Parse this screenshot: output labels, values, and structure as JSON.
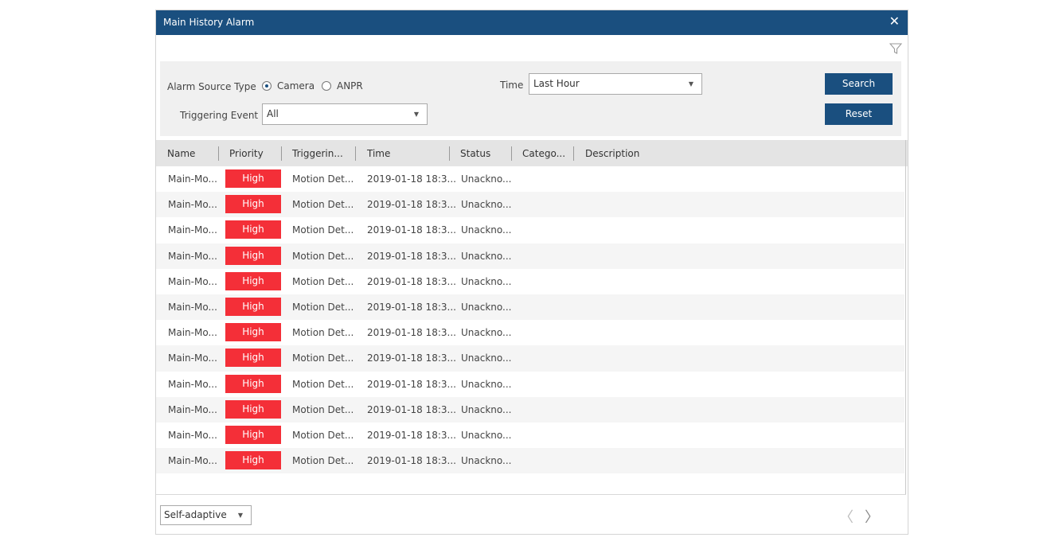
{
  "window": {
    "title": "Main History Alarm",
    "close_glyph": "✕",
    "close_icon": "close-icon",
    "filter_icon": "funnel-icon"
  },
  "filters": {
    "alarm_source_label": "Alarm Source Type",
    "source_options": [
      "Camera",
      "ANPR"
    ],
    "source_selected": "Camera",
    "time_label": "Time",
    "time_value": "Last Hour",
    "triggering_label": "Triggering Event",
    "triggering_value": "All",
    "search_label": "Search",
    "reset_label": "Reset"
  },
  "table": {
    "columns": [
      "Name",
      "Priority",
      "Triggerin...",
      "Time",
      "Status",
      "Catego...",
      "Description"
    ],
    "rows": [
      {
        "name": "Main-Mo...",
        "priority": "High",
        "trigger": "Motion Det...",
        "time": "2019-01-18 18:3...",
        "status": "Unackno..."
      },
      {
        "name": "Main-Mo...",
        "priority": "High",
        "trigger": "Motion Det...",
        "time": "2019-01-18 18:3...",
        "status": "Unackno..."
      },
      {
        "name": "Main-Mo...",
        "priority": "High",
        "trigger": "Motion Det...",
        "time": "2019-01-18 18:3...",
        "status": "Unackno..."
      },
      {
        "name": "Main-Mo...",
        "priority": "High",
        "trigger": "Motion Det...",
        "time": "2019-01-18 18:3...",
        "status": "Unackno..."
      },
      {
        "name": "Main-Mo...",
        "priority": "High",
        "trigger": "Motion Det...",
        "time": "2019-01-18 18:3...",
        "status": "Unackno..."
      },
      {
        "name": "Main-Mo...",
        "priority": "High",
        "trigger": "Motion Det...",
        "time": "2019-01-18 18:3...",
        "status": "Unackno..."
      },
      {
        "name": "Main-Mo...",
        "priority": "High",
        "trigger": "Motion Det...",
        "time": "2019-01-18 18:3...",
        "status": "Unackno..."
      },
      {
        "name": "Main-Mo...",
        "priority": "High",
        "trigger": "Motion Det...",
        "time": "2019-01-18 18:3...",
        "status": "Unackno..."
      },
      {
        "name": "Main-Mo...",
        "priority": "High",
        "trigger": "Motion Det...",
        "time": "2019-01-18 18:3...",
        "status": "Unackno..."
      },
      {
        "name": "Main-Mo...",
        "priority": "High",
        "trigger": "Motion Det...",
        "time": "2019-01-18 18:3...",
        "status": "Unackno..."
      },
      {
        "name": "Main-Mo...",
        "priority": "High",
        "trigger": "Motion Det...",
        "time": "2019-01-18 18:3...",
        "status": "Unackno..."
      },
      {
        "name": "Main-Mo...",
        "priority": "High",
        "trigger": "Motion Det...",
        "time": "2019-01-18 18:3...",
        "status": "Unackno..."
      }
    ]
  },
  "footer": {
    "layout_mode": "Self-adaptive",
    "prev_glyph": "〈",
    "next_glyph": "〉"
  },
  "colors": {
    "titlebar": "#1a4f7f",
    "button": "#1a4f7f",
    "priority_high": "#f42f38"
  }
}
